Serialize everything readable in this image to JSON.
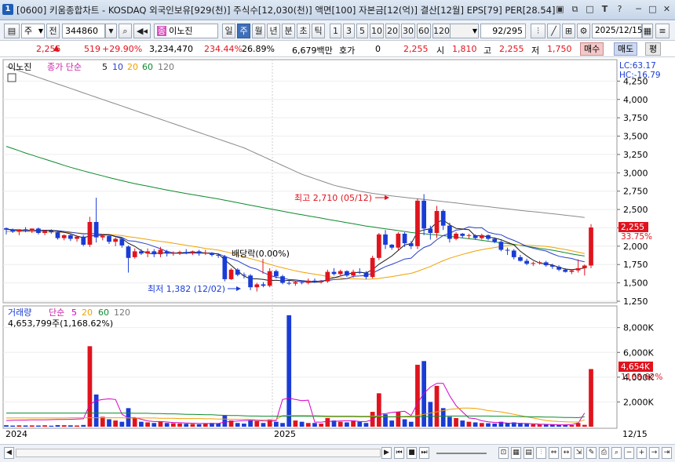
{
  "window": {
    "badge": "1",
    "title": "[0600] 키움종합차트 - KOSDAQ 외국인보유[929(천)] 주식수[12,030(천)] 액면[100] 자본금[12(억)] 결산[12월] EPS[79] PER[28.54]"
  },
  "titlebar_icons": [
    "save-icon",
    "restore-icon",
    "window-icon",
    "text-icon",
    "help-icon",
    "minimize-icon",
    "maximize-icon",
    "close-icon"
  ],
  "toolbar": {
    "market": "주",
    "market_mode": "전",
    "code": "344860",
    "stock_name": "이노진",
    "stock_badge": "종",
    "periods": [
      "일",
      "주",
      "월",
      "년",
      "분",
      "초",
      "틱"
    ],
    "active_period": "주",
    "intervals": [
      "1",
      "3",
      "5",
      "10",
      "20",
      "30",
      "60",
      "120"
    ],
    "count": "92",
    "total": "/295",
    "date": "2025/12/15"
  },
  "quote": {
    "price": "2,255",
    "change": "519",
    "change_pct": "+29.90%",
    "volume": "3,234,470",
    "vol_ratio": "234.44%",
    "turnover": "26.89%",
    "amount": "6,679백만",
    "hoga_label": "호가",
    "hoga_value": "0",
    "cur": "2,255",
    "open_label": "시",
    "open": "1,810",
    "high_label": "고",
    "high": "2,255",
    "low_label": "저",
    "low": "1,750",
    "buy": "매수",
    "sell": "매도",
    "avg": "평"
  },
  "price_pane": {
    "name": "이노진",
    "legend": "종가 단순",
    "ma": [
      "5",
      "10",
      "20",
      "60",
      "120"
    ],
    "lc": "LC:63.17",
    "hc": "HC:-16.79",
    "last_price": "2,255",
    "last_pct": "33.75%",
    "high_annot": "최고 2,710 (05/12)",
    "low_annot": "최저 1,382 (12/02)",
    "div_annot": "배당락(0.00%)"
  },
  "vol_pane": {
    "name": "거래량",
    "legend": "단순",
    "ma": [
      "5",
      "20",
      "60",
      "120"
    ],
    "info": "4,653,799주(1,168.62%)",
    "last_vol": "4,654K",
    "last_pct": "1168.62%"
  },
  "x_axis": {
    "labels": [
      "2024",
      "2025"
    ],
    "right_label": "12/15"
  },
  "colors": {
    "up": "#e0141e",
    "down": "#1a3cd6",
    "ma5": "#1a1a1a",
    "ma10": "#2a3fc7",
    "ma20": "#f0a100",
    "ma60": "#0d8a2e",
    "ma120": "#8a8a8a",
    "vol_ma5": "#d400c8"
  },
  "chart_data": {
    "type": "candlestick",
    "price_axis": {
      "min": 1250,
      "max": 4500,
      "ticks": [
        "1,250",
        "1,500",
        "1,750",
        "2,000",
        "2,250",
        "2,500",
        "2,750",
        "3,000",
        "3,250",
        "3,500",
        "3,750",
        "4,000",
        "4,250"
      ]
    },
    "volume_axis": {
      "min": 0,
      "max": 9500,
      "unit": "K",
      "ticks": [
        "2,000K",
        "4,000K",
        "6,000K",
        "8,000K"
      ]
    },
    "candles": [
      [
        2245,
        2255,
        2160,
        2225,
        120
      ],
      [
        2225,
        2240,
        2180,
        2200,
        90
      ],
      [
        2200,
        2230,
        2150,
        2230,
        110
      ],
      [
        2230,
        2260,
        2190,
        2210,
        100
      ],
      [
        2210,
        2240,
        2180,
        2240,
        105
      ],
      [
        2240,
        2255,
        2160,
        2180,
        95
      ],
      [
        2180,
        2220,
        2150,
        2210,
        115
      ],
      [
        2210,
        2230,
        2170,
        2190,
        80
      ],
      [
        2190,
        2210,
        2090,
        2110,
        130
      ],
      [
        2110,
        2160,
        2080,
        2150,
        120
      ],
      [
        2150,
        2170,
        2070,
        2100,
        110
      ],
      [
        2100,
        2140,
        2060,
        2130,
        100
      ],
      [
        2130,
        2150,
        2000,
        2020,
        140
      ],
      [
        2020,
        2400,
        1990,
        2330,
        6500
      ],
      [
        2330,
        2660,
        2050,
        2120,
        2600
      ],
      [
        2120,
        2160,
        2080,
        2140,
        800
      ],
      [
        2140,
        2160,
        2030,
        2060,
        600
      ],
      [
        2060,
        2120,
        2000,
        2100,
        500
      ],
      [
        2100,
        2110,
        1980,
        2010,
        400
      ],
      [
        1995,
        2010,
        1640,
        1840,
        1500
      ],
      [
        1850,
        1970,
        1830,
        1930,
        700
      ],
      [
        1930,
        1960,
        1880,
        1900,
        400
      ],
      [
        1900,
        1970,
        1850,
        1930,
        350
      ],
      [
        1930,
        1960,
        1850,
        1890,
        300
      ],
      [
        1890,
        1990,
        1850,
        1950,
        400
      ],
      [
        1930,
        1950,
        1860,
        1900,
        300
      ],
      [
        1900,
        1930,
        1870,
        1910,
        280
      ],
      [
        1910,
        1940,
        1880,
        1920,
        260
      ],
      [
        1920,
        1960,
        1890,
        1910,
        240
      ],
      [
        1910,
        1940,
        1880,
        1930,
        220
      ],
      [
        1930,
        1950,
        1870,
        1900,
        200
      ],
      [
        1900,
        1950,
        1880,
        1910,
        250
      ],
      [
        1910,
        1920,
        1860,
        1880,
        300
      ],
      [
        1880,
        1900,
        1840,
        1870,
        260
      ],
      [
        1860,
        1880,
        1520,
        1550,
        900
      ],
      [
        1550,
        1700,
        1540,
        1680,
        500
      ],
      [
        1680,
        1700,
        1590,
        1610,
        300
      ],
      [
        1610,
        1640,
        1560,
        1600,
        250
      ],
      [
        1600,
        1620,
        1400,
        1440,
        500
      ],
      [
        1440,
        1500,
        1382,
        1480,
        450
      ],
      [
        1480,
        1510,
        1440,
        1460,
        300
      ],
      [
        1460,
        1700,
        1440,
        1660,
        600
      ],
      [
        1660,
        1680,
        1560,
        1590,
        400
      ],
      [
        1590,
        1610,
        1480,
        1500,
        300
      ],
      [
        1500,
        1540,
        1470,
        1490,
        9000
      ],
      [
        1490,
        1520,
        1460,
        1510,
        500
      ],
      [
        1510,
        1530,
        1480,
        1500,
        400
      ],
      [
        1500,
        1560,
        1480,
        1530,
        300
      ],
      [
        1530,
        1560,
        1500,
        1510,
        300
      ],
      [
        1510,
        1540,
        1490,
        1520,
        250
      ],
      [
        1520,
        1680,
        1500,
        1650,
        700
      ],
      [
        1650,
        1700,
        1600,
        1620,
        500
      ],
      [
        1620,
        1680,
        1590,
        1660,
        400
      ],
      [
        1660,
        1670,
        1580,
        1600,
        350
      ],
      [
        1600,
        1680,
        1570,
        1650,
        450
      ],
      [
        1650,
        1700,
        1620,
        1640,
        400
      ],
      [
        1640,
        1660,
        1550,
        1580,
        300
      ],
      [
        1580,
        1870,
        1560,
        1840,
        1200
      ],
      [
        1840,
        2180,
        1810,
        2160,
        2700
      ],
      [
        2160,
        2220,
        1960,
        2020,
        1000
      ],
      [
        2020,
        2030,
        1950,
        1980,
        500
      ],
      [
        1980,
        2190,
        1950,
        2170,
        1200
      ],
      [
        2170,
        2190,
        1990,
        2040,
        600
      ],
      [
        2040,
        2070,
        1960,
        2000,
        400
      ],
      [
        2000,
        2650,
        1960,
        2620,
        5000
      ],
      [
        2620,
        2710,
        2150,
        2240,
        5300
      ],
      [
        2240,
        2280,
        2090,
        2180,
        2000
      ],
      [
        2180,
        2550,
        2110,
        2480,
        3300
      ],
      [
        2480,
        2500,
        2220,
        2280,
        1500
      ],
      [
        2280,
        2320,
        2050,
        2100,
        800
      ],
      [
        2100,
        2190,
        2080,
        2170,
        700
      ],
      [
        2170,
        2180,
        2110,
        2140,
        500
      ],
      [
        2140,
        2170,
        2100,
        2150,
        400
      ],
      [
        2150,
        2160,
        2090,
        2110,
        350
      ],
      [
        2110,
        2170,
        2090,
        2150,
        300
      ],
      [
        2150,
        2160,
        2080,
        2100,
        280
      ],
      [
        2100,
        2120,
        2040,
        2060,
        260
      ],
      [
        2060,
        2080,
        1930,
        1950,
        400
      ],
      [
        1950,
        1980,
        1880,
        1940,
        300
      ],
      [
        1940,
        1960,
        1820,
        1850,
        350
      ],
      [
        1850,
        1880,
        1790,
        1800,
        300
      ],
      [
        1800,
        1830,
        1740,
        1760,
        250
      ],
      [
        1760,
        1790,
        1730,
        1770,
        200
      ],
      [
        1770,
        1800,
        1750,
        1780,
        180
      ],
      [
        1780,
        1800,
        1720,
        1740,
        170
      ],
      [
        1740,
        1760,
        1690,
        1720,
        160
      ],
      [
        1720,
        1740,
        1660,
        1680,
        150
      ],
      [
        1680,
        1700,
        1640,
        1650,
        140
      ],
      [
        1650,
        1680,
        1620,
        1670,
        130
      ],
      [
        1670,
        1820,
        1640,
        1700,
        300
      ],
      [
        1700,
        1750,
        1600,
        1736,
        150
      ],
      [
        1736,
        2300,
        1700,
        2255,
        4654
      ]
    ],
    "ma5": [
      2230,
      2221,
      2214,
      2212,
      2213,
      2213,
      2215,
      2216,
      2204,
      2189,
      2168,
      2137,
      2115,
      2138,
      2144,
      2150,
      2156,
      2131,
      2106,
      2040,
      1998,
      1938,
      1904,
      1896,
      1913,
      1904,
      1903,
      1908,
      1915,
      1915,
      1914,
      1909,
      1902,
      1892,
      1814,
      1740,
      1665,
      1592,
      1555,
      1555,
      1546,
      1530,
      1535,
      1527,
      1534,
      1526,
      1524,
      1509,
      1509,
      1511,
      1547,
      1570,
      1593,
      1615,
      1640,
      1642,
      1636,
      1681,
      1754,
      1809,
      1866,
      1943,
      2018,
      2034,
      2196,
      2221,
      2239,
      2324,
      2358,
      2292,
      2242,
      2234,
      2224,
      2137,
      2146,
      2125,
      2111,
      2088,
      2052,
      2019,
      1931,
      1867,
      1809,
      1770,
      1757,
      1744,
      1712,
      1688,
      1680,
      1689,
      1703
    ],
    "ma10": [
      2230,
      2225,
      2222,
      2218,
      2217,
      2217,
      2217,
      2215,
      2211,
      2202,
      2191,
      2179,
      2166,
      2171,
      2166,
      2159,
      2156,
      2133,
      2120,
      2074,
      2068,
      2047,
      2027,
      1996,
      1965,
      1928,
      1910,
      1902,
      1903,
      1908,
      1906,
      1904,
      1902,
      1895,
      1862,
      1828,
      1800,
      1754,
      1710,
      1686,
      1641,
      1604,
      1576,
      1565,
      1545,
      1542,
      1530,
      1523,
      1518,
      1528,
      1530,
      1545,
      1548,
      1558,
      1589,
      1594,
      1602,
      1632,
      1678,
      1721,
      1753,
      1788,
      1825,
      1837,
      1919,
      1982,
      2014,
      2088,
      2145,
      2176,
      2219,
      2229,
      2262,
      2250,
      2252,
      2190,
      2168,
      2156,
      2111,
      2079,
      2039,
      1997,
      1973,
      1951,
      1934,
      1896,
      1863,
      1845,
      1833,
      1806,
      1788
    ],
    "ma20": [
      2200,
      2200,
      2199,
      2198,
      2197,
      2196,
      2195,
      2194,
      2192,
      2189,
      2185,
      2180,
      2175,
      2172,
      2168,
      2164,
      2160,
      2152,
      2145,
      2130,
      2118,
      2105,
      2092,
      2078,
      2066,
      2055,
      2040,
      2026,
      2012,
      1998,
      1984,
      1970,
      1958,
      1946,
      1927,
      1905,
      1882,
      1854,
      1830,
      1808,
      1779,
      1752,
      1728,
      1705,
      1685,
      1664,
      1647,
      1632,
      1618,
      1604,
      1587,
      1575,
      1566,
      1558,
      1555,
      1551,
      1549,
      1552,
      1560,
      1573,
      1586,
      1600,
      1616,
      1629,
      1657,
      1690,
      1722,
      1764,
      1802,
      1836,
      1863,
      1888,
      1912,
      1934,
      1951,
      1967,
      1981,
      1995,
      2006,
      2013,
      2015,
      2012,
      2008,
      2003,
      1997,
      1985,
      1970,
      1955,
      1937,
      1918,
      1900
    ],
    "ma60": [
      3360,
      3330,
      3300,
      3270,
      3242,
      3214,
      3186,
      3158,
      3130,
      3102,
      3075,
      3050,
      3027,
      3003,
      2980,
      2958,
      2935,
      2913,
      2892,
      2873,
      2853,
      2835,
      2818,
      2800,
      2783,
      2766,
      2750,
      2734,
      2718,
      2703,
      2688,
      2673,
      2658,
      2644,
      2627,
      2610,
      2593,
      2576,
      2559,
      2542,
      2525,
      2508,
      2492,
      2476,
      2459,
      2443,
      2428,
      2413,
      2398,
      2383,
      2366,
      2351,
      2336,
      2320,
      2305,
      2290,
      2274,
      2262,
      2250,
      2237,
      2225,
      2212,
      2200,
      2187,
      2178,
      2170,
      2160,
      2153,
      2143,
      2133,
      2123,
      2112,
      2101,
      2091,
      2080,
      2068,
      2057,
      2046,
      2036,
      2024,
      2011,
      1998,
      1985,
      1971,
      1958,
      1945,
      1929,
      1912,
      1895,
      1880,
      1866
    ],
    "ma120": [
      4450,
      4420,
      4390,
      4360,
      4330,
      4300,
      4270,
      4240,
      4210,
      4180,
      4150,
      4120,
      4090,
      4060,
      4030,
      4000,
      3970,
      3940,
      3910,
      3880,
      3850,
      3820,
      3790,
      3760,
      3730,
      3700,
      3670,
      3640,
      3610,
      3580,
      3550,
      3520,
      3490,
      3460,
      3430,
      3400,
      3370,
      3340,
      3300,
      3260,
      3220,
      3180,
      3140,
      3100,
      3060,
      3020,
      2980,
      2950,
      2920,
      2890,
      2860,
      2830,
      2810,
      2790,
      2770,
      2750,
      2735,
      2720,
      2708,
      2696,
      2685,
      2675,
      2665,
      2655,
      2646,
      2637,
      2628,
      2618,
      2608,
      2598,
      2588,
      2578,
      2568,
      2558,
      2548,
      2538,
      2528,
      2518,
      2508,
      2498,
      2488,
      2478,
      2470,
      2462,
      2452,
      2442,
      2432,
      2422,
      2412,
      2402,
      2392
    ],
    "vol_ma5": [
      500,
      520,
      530,
      540,
      550,
      560,
      560,
      570,
      580,
      590,
      600,
      620,
      640,
      1800,
      2100,
      2200,
      2250,
      2200,
      1000,
      700,
      740,
      600,
      470,
      420,
      420,
      380,
      340,
      320,
      300,
      280,
      260,
      260,
      260,
      260,
      380,
      420,
      460,
      490,
      520,
      500,
      470,
      460,
      480,
      2200,
      2300,
      2200,
      2100,
      2150,
      380,
      360,
      440,
      440,
      460,
      480,
      480,
      420,
      420,
      560,
      1000,
      1050,
      1150,
      1200,
      1250,
      900,
      1900,
      2700,
      3200,
      3500,
      3500,
      2500,
      1700,
      1200,
      700,
      650,
      480,
      400,
      350,
      320,
      290,
      280,
      270,
      260,
      240,
      210,
      190,
      170,
      150,
      150,
      180,
      290,
      1100
    ],
    "vol_ma20": [
      700,
      700,
      700,
      700,
      700,
      700,
      700,
      700,
      700,
      700,
      720,
      720,
      720,
      720,
      720,
      720,
      720,
      720,
      720,
      700,
      700,
      700,
      700,
      700,
      680,
      680,
      680,
      660,
      660,
      660,
      660,
      640,
      640,
      620,
      620,
      600,
      600,
      600,
      580,
      560,
      560,
      560,
      580,
      900,
      900,
      900,
      900,
      900,
      900,
      880,
      870,
      860,
      860,
      860,
      860,
      850,
      850,
      860,
      860,
      800,
      800,
      820,
      840,
      860,
      900,
      1000,
      1100,
      1200,
      1300,
      1400,
      1450,
      1500,
      1500,
      1480,
      1400,
      1300,
      1250,
      1200,
      1100,
      1000,
      900,
      800,
      700,
      600,
      500,
      450,
      420,
      400,
      380,
      380,
      560
    ],
    "vol_ma60": [
      1100,
      1100,
      1100,
      1100,
      1100,
      1100,
      1100,
      1100,
      1100,
      1100,
      1100,
      1100,
      1100,
      1100,
      1100,
      1100,
      1100,
      1100,
      1100,
      1100,
      1080,
      1080,
      1080,
      1060,
      1060,
      1040,
      1040,
      1020,
      1000,
      1000,
      980,
      960,
      960,
      940,
      920,
      900,
      900,
      880,
      860,
      860,
      850,
      850,
      850,
      850,
      850,
      850,
      850,
      840,
      840,
      830,
      820,
      820,
      820,
      820,
      820,
      810,
      810,
      810,
      800,
      800,
      800,
      800,
      800,
      800,
      810,
      820,
      830,
      840,
      850,
      860,
      860,
      860,
      860,
      860,
      860,
      860,
      850,
      850,
      840,
      830,
      820,
      810,
      800,
      790,
      780,
      770,
      760,
      750,
      740,
      730,
      800
    ]
  }
}
